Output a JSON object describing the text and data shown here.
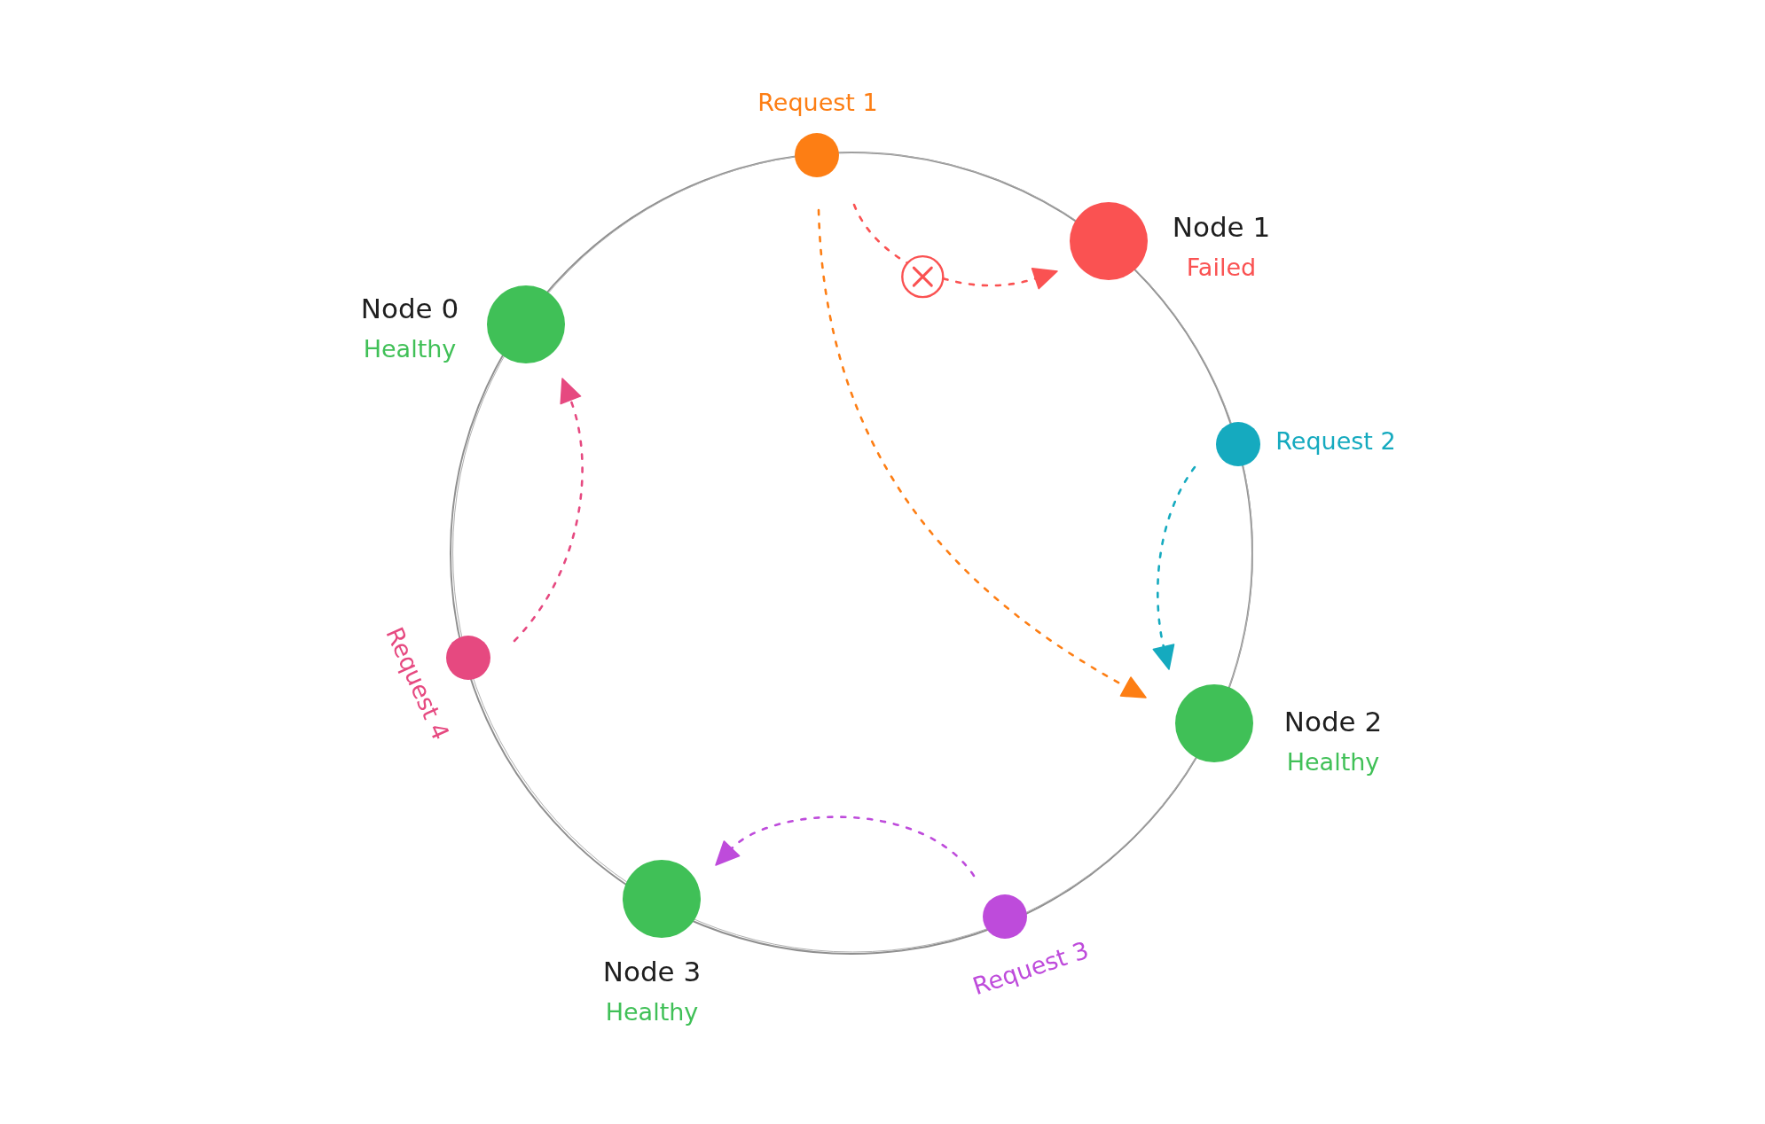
{
  "ring": {
    "nodes": [
      {
        "label": "Node 0",
        "status": "Healthy",
        "failed": false
      },
      {
        "label": "Node 1",
        "status": "Failed",
        "failed": true
      },
      {
        "label": "Node 2",
        "status": "Healthy",
        "failed": false
      },
      {
        "label": "Node 3",
        "status": "Healthy",
        "failed": false
      }
    ],
    "requests": [
      {
        "label": "Request 1",
        "color": "#fd7e14",
        "routes": [
          {
            "blocked": true
          },
          {
            "blocked": false
          }
        ]
      },
      {
        "label": "Request 2",
        "color": "#15aabf",
        "routes": [
          {
            "blocked": false
          }
        ]
      },
      {
        "label": "Request 3",
        "color": "#be4bdb",
        "routes": [
          {
            "blocked": false
          }
        ]
      },
      {
        "label": "Request 4",
        "color": "#e64980",
        "routes": [
          {
            "blocked": false
          }
        ]
      }
    ]
  }
}
